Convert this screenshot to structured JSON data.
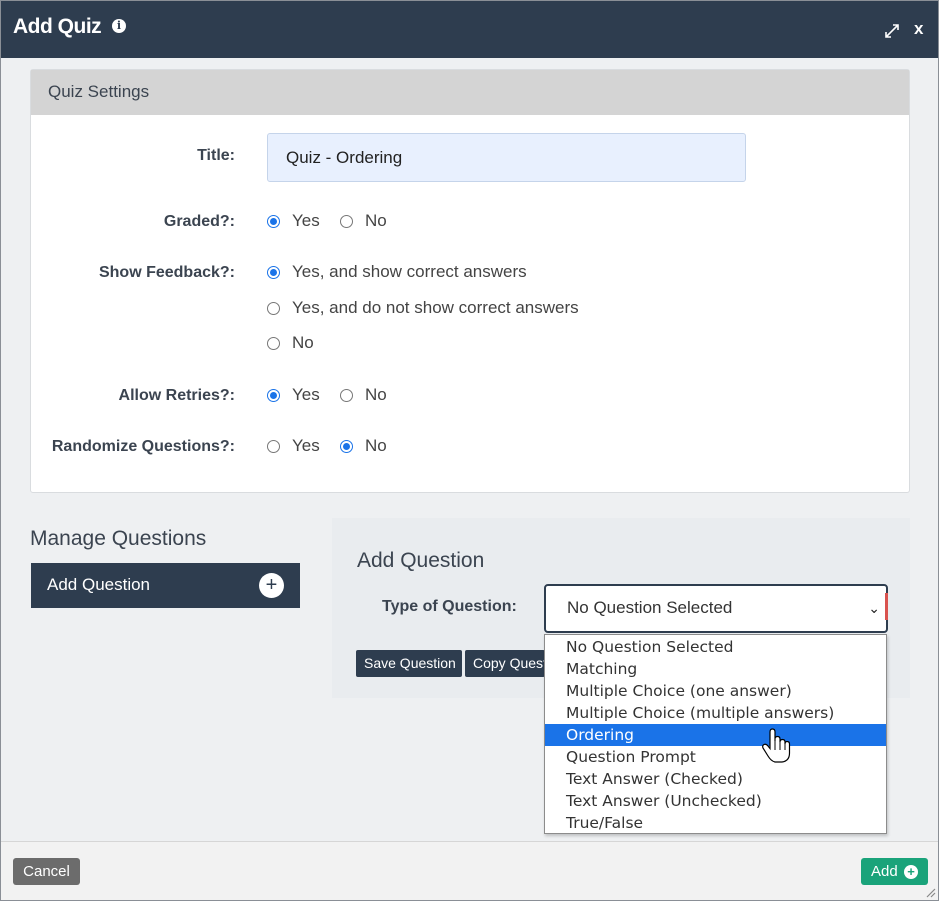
{
  "dialog": {
    "title": "Add Quiz",
    "info_icon": "info-icon",
    "expand_icon": "expand-icon",
    "close_label": "x"
  },
  "quiz_settings": {
    "header": "Quiz Settings",
    "title_label": "Title:",
    "title_value": "Quiz - Ordering",
    "graded": {
      "label": "Graded?:",
      "options": [
        "Yes",
        "No"
      ],
      "selected": "Yes"
    },
    "show_feedback": {
      "label": "Show Feedback?:",
      "options": [
        "Yes, and show correct answers",
        "Yes, and do not show correct answers",
        "No"
      ],
      "selected": "Yes, and show correct answers"
    },
    "allow_retries": {
      "label": "Allow Retries?:",
      "options": [
        "Yes",
        "No"
      ],
      "selected": "Yes"
    },
    "randomize_questions": {
      "label": "Randomize Questions?:",
      "options": [
        "Yes",
        "No"
      ],
      "selected": "No"
    }
  },
  "manage_questions": {
    "title": "Manage Questions",
    "add_question_label": "Add Question",
    "add_icon": "plus-icon"
  },
  "add_question": {
    "title": "Add Question",
    "type_label": "Type of Question:",
    "type_selected": "No Question Selected",
    "type_options": [
      "No Question Selected",
      "Matching",
      "Multiple Choice (one answer)",
      "Multiple Choice (multiple answers)",
      "Ordering",
      "Question Prompt",
      "Text Answer (Checked)",
      "Text Answer (Unchecked)",
      "True/False"
    ],
    "highlighted_option": "Ordering",
    "save_label": "Save Question",
    "copy_label": "Copy Question"
  },
  "footer": {
    "cancel_label": "Cancel",
    "add_label": "Add"
  },
  "colors": {
    "titlebar": "#2e3d4f",
    "accent_blue": "#1a73e8",
    "add_green": "#1aa37a",
    "cancel_gray": "#6c6c6c"
  }
}
